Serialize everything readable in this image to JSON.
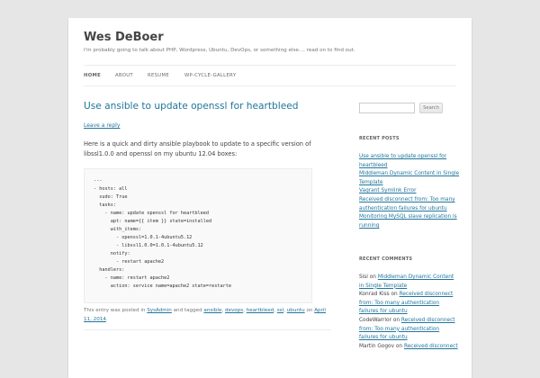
{
  "site": {
    "title": "Wes DeBoer",
    "description": "I'm probably going to talk about PHP, Wordpress, Ubuntu, DevOps, or something else.... read on to find out."
  },
  "nav": {
    "items": [
      {
        "label": "HOME",
        "current": true
      },
      {
        "label": "ABOUT",
        "current": false
      },
      {
        "label": "RESUME",
        "current": false
      },
      {
        "label": "WP-CYCLE-GALLERY",
        "current": false
      }
    ]
  },
  "post": {
    "title": "Use ansible to update openssl for heartbleed",
    "leave_reply": "Leave a reply",
    "intro": "Here is a quick and dirty ansible playbook to update to a specific version of libssl1.0.0 and openssl on my ubuntu 12.04 boxes:",
    "code": [
      "---",
      "- hosts: all",
      "  sudo: True",
      "  tasks:",
      "    - name: update openssl for heartbleed",
      "      apt: name={{ item }} state=installed",
      "      with_items:",
      "        - openssl=1.0.1-4ubuntu5.12",
      "        - libssl1.0.0=1.0.1-4ubuntu5.12",
      "      notify:",
      "        - restart apache2",
      "  handlers:",
      "    - name: restart apache2",
      "      action: service name=apache2 state=restarte"
    ],
    "meta": {
      "prefix": "This entry was posted in",
      "category": "SysAdmin",
      "tagged_text": "and tagged",
      "tags": [
        "ansible",
        "devops",
        "heartbleed",
        "ssl",
        "ubuntu"
      ],
      "on_text": "on",
      "date": "April 11, 2014"
    }
  },
  "sidebar": {
    "search": {
      "placeholder": "",
      "button_label": "Search"
    },
    "recent_posts": {
      "title": "RECENT POSTS",
      "items": [
        "Use ansible to update openssl for heartbleed",
        "Middleman Dynamic Content in Single Template",
        "Vagrant Symlink Error",
        "Received disconnect from: Too many authentication failures for ubuntu",
        "Monitoring MySQL slave replication is running"
      ]
    },
    "recent_comments": {
      "title": "RECENT COMMENTS",
      "items": [
        {
          "author": "Sisi",
          "on": "on",
          "post": "Middleman Dynamic Content in Single Template"
        },
        {
          "author": "Konrad Kiss",
          "on": "on",
          "post": "Received disconnect from: Too many authentication failures for ubuntu"
        },
        {
          "author": "CodeWarrior",
          "on": "on",
          "post": "Received disconnect from: Too many authentication failures for ubuntu"
        },
        {
          "author": "Martin Gogov",
          "on": "on",
          "post": "Received disconnect"
        }
      ]
    }
  },
  "colors": {
    "link": "#21759b",
    "page_bg": "#e6e6e6",
    "content_bg": "#ffffff",
    "text": "#444444"
  }
}
